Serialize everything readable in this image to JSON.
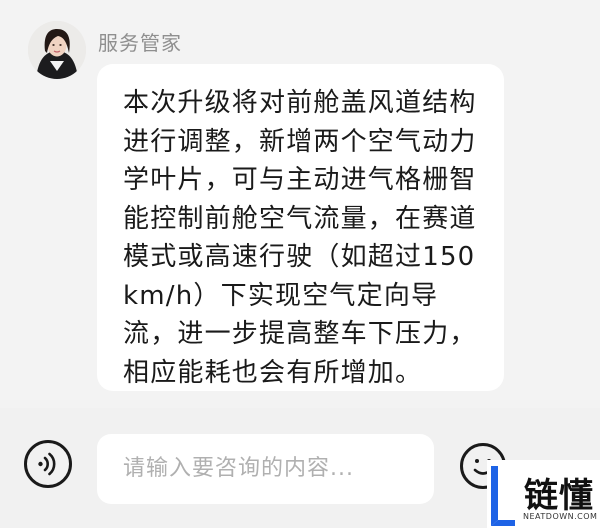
{
  "sender": {
    "name": "服务管家",
    "avatar_icon": "assistant-avatar"
  },
  "message": {
    "text": "本次升级将对前舱盖风道结构进行调整，新增两个空气动力学叶片，可与主动进气格栅智能控制前舱空气流量，在赛道模式或高速行驶（如超过150km/h）下实现空气定向导流，进一步提高整车下压力，相应能耗也会有所增加。"
  },
  "composer": {
    "placeholder": "请输入要咨询的内容...",
    "voice_icon": "voice-input-icon",
    "emoji_icon": "emoji-icon"
  },
  "watermark": {
    "title": "链懂",
    "subtitle": "NEATDOWN.COM"
  },
  "colors": {
    "background": "#f3f3f3",
    "bubble": "#ffffff",
    "text": "#1a1a1a",
    "muted": "#8f8f8f",
    "watermark_blue": "#1e63e6"
  }
}
